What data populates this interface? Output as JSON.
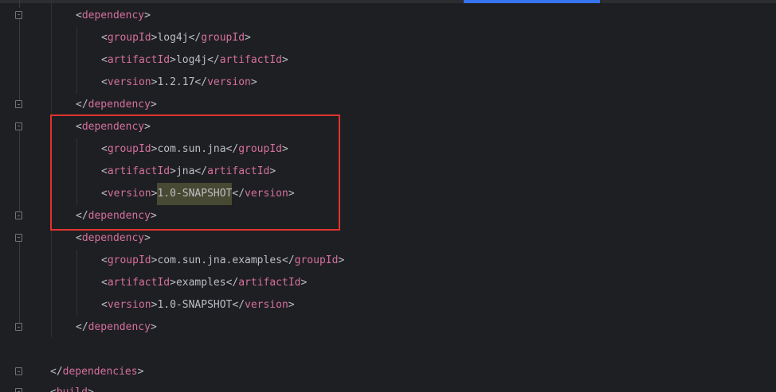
{
  "editor": {
    "language": "xml",
    "colors": {
      "background": "#1e1f22",
      "tag": "#d5709f",
      "text": "#bcbec4",
      "bracket": "#bcbec4",
      "selection_highlight": "#484932",
      "annotation_box": "#e0332f",
      "active_tab": "#3574f0"
    },
    "lines": [
      {
        "open": "<",
        "tag": "dependency",
        "close": ">"
      },
      {
        "open": "<",
        "tag": "groupId",
        "mid": ">",
        "value": "log4j",
        "end_open": "</",
        "end_tag": "groupId",
        "end_close": ">"
      },
      {
        "open": "<",
        "tag": "artifactId",
        "mid": ">",
        "value": "log4j",
        "end_open": "</",
        "end_tag": "artifactId",
        "end_close": ">"
      },
      {
        "open": "<",
        "tag": "version",
        "mid": ">",
        "value": "1.2.17",
        "end_open": "</",
        "end_tag": "version",
        "end_close": ">"
      },
      {
        "open": "</",
        "tag": "dependency",
        "close": ">"
      },
      {
        "open": "<",
        "tag": "dependency",
        "close": ">"
      },
      {
        "open": "<",
        "tag": "groupId",
        "mid": ">",
        "value": "com.sun.jna",
        "end_open": "</",
        "end_tag": "groupId",
        "end_close": ">"
      },
      {
        "open": "<",
        "tag": "artifactId",
        "mid": ">",
        "value": "jna",
        "end_open": "</",
        "end_tag": "artifactId",
        "end_close": ">"
      },
      {
        "open": "<",
        "tag": "version",
        "mid": ">",
        "value": "1.0-SNAPSHOT",
        "end_open": "</",
        "end_tag": "version",
        "end_close": ">"
      },
      {
        "open": "</",
        "tag": "dependency",
        "close": ">"
      },
      {
        "open": "<",
        "tag": "dependency",
        "close": ">"
      },
      {
        "open": "<",
        "tag": "groupId",
        "mid": ">",
        "value": "com.sun.jna.examples",
        "end_open": "</",
        "end_tag": "groupId",
        "end_close": ">"
      },
      {
        "open": "<",
        "tag": "artifactId",
        "mid": ">",
        "value": "examples",
        "end_open": "</",
        "end_tag": "artifactId",
        "end_close": ">"
      },
      {
        "open": "<",
        "tag": "version",
        "mid": ">",
        "value": "1.0-SNAPSHOT",
        "end_open": "</",
        "end_tag": "version",
        "end_close": ">"
      },
      {
        "open": "</",
        "tag": "dependency",
        "close": ">"
      },
      {
        "open": "</",
        "tag": "dependencies",
        "close": ">"
      },
      {
        "open": "<",
        "tag": "build",
        "close": ">"
      }
    ]
  }
}
